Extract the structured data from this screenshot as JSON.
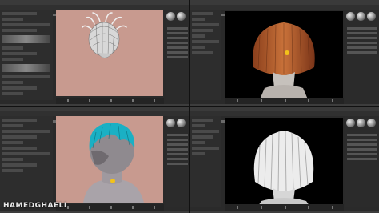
{
  "watermark": "HAMEDGHAELI",
  "colors": {
    "viewport_bg": "#000000",
    "pink_canvas": "#c89a8f",
    "hair_orange": "#b8612f",
    "hair_teal": "#1ab0c4",
    "hair_white": "#ececec",
    "marker": "#f2c21b"
  },
  "viewports": [
    {
      "content": "wireframe-hair-head-on-pink",
      "icon": "sculpt-hair-icon"
    },
    {
      "content": "orange-bob-hair-render",
      "icon": "hair-render-icon"
    },
    {
      "content": "teal-undercut-hair-render-on-pink",
      "icon": "hair-render-icon"
    },
    {
      "content": "white-bob-hair-render",
      "icon": "hair-render-icon"
    }
  ]
}
